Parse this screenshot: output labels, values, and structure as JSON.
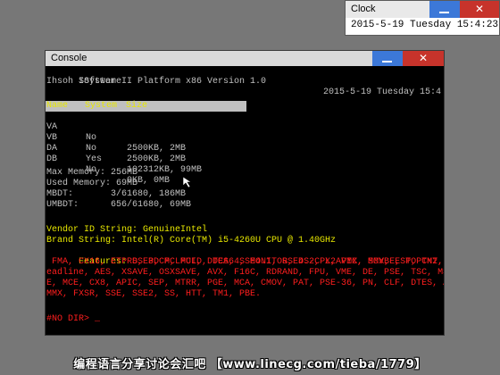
{
  "clock": {
    "title": "Clock",
    "datetime": "2015-5-19 Tuesday 15:4:23",
    "close_glyph": "✕"
  },
  "console": {
    "title": "Console",
    "close_glyph": "✕",
    "header_left": "ISystem II Platform x86 Version 1.0",
    "header_right": "2015-5-19 Tuesday 15:4",
    "vendor_line": "Ihsoh Software",
    "drive_table": {
      "headers": [
        "Name",
        "System",
        "Size"
      ],
      "rows": [
        [
          "VA",
          "No",
          "2500KB, 2MB"
        ],
        [
          "VB",
          "No",
          "2500KB, 2MB"
        ],
        [
          "DA",
          "Yes",
          "102312KB, 99MB"
        ],
        [
          "DB",
          "No",
          "0KB, 0MB"
        ]
      ]
    },
    "memory": [
      "Max Memory: 256MB",
      "Used Memory: 69MB",
      "MBDT:       3/61680, 186MB",
      "UMBDT:      656/61680, 69MB"
    ],
    "cpu": {
      "vendor": "Vendor ID String: GenuineIntel",
      "brand": "Brand String: Intel(R) Core(TM) i5-4260U CPU @ 1.40GHz",
      "features_label": "Features: ",
      "features_first": "SSE3, PCLMUL, DTES64, MONITOR, DS-CPL, VMX, SMX, EST, TM2, SSSE3, CID,",
      "features_lines": [
        " FMA, CX16, ETPRD, PDCM, PCID, DCA, SSE4.1, SSE4.2, X2APIC, MOVBE, POPCNT, TSC-D",
        "eadline, AES, XSAVE, OSXSAVE, AVX, F16C, RDRAND, FPU, VME, DE, PSE, TSC, MSR, PA",
        "E, MCE, CX8, APIC, SEP, MTRR, PGE, MCA, CMOV, PAT, PSE-36, PN, CLF, DTES, ACPI,",
        "MMX, FXSR, SSE, SSE2, SS, HTT, TM1, PBE."
      ]
    },
    "prompt": "#NO DIR> _"
  },
  "watermark": "编程语言分享讨论会汇吧 【www.linecg.com/tieba/1779】",
  "colors": {
    "desktop": "#777777",
    "console_bg": "#000000",
    "text_gray": "#c0c0c0",
    "text_yellow": "#e8e800",
    "text_red": "#ff1e1e",
    "close_red": "#c7332b",
    "min_blue": "#3c78d8"
  },
  "icons": [
    "minimize-icon",
    "close-icon",
    "mouse-pointer-icon"
  ]
}
